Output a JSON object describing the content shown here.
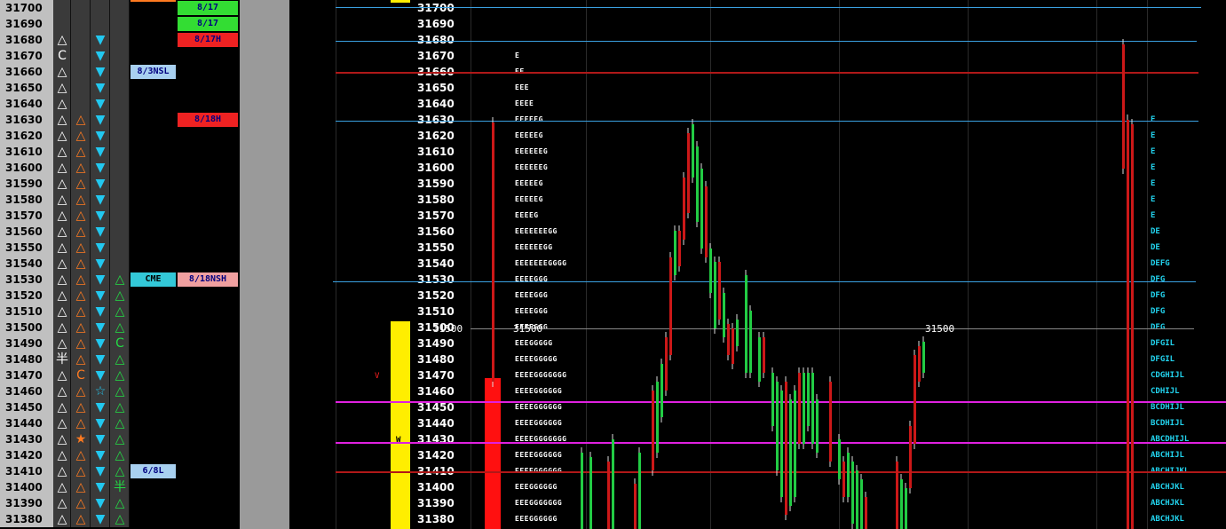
{
  "rows": [
    {
      "price": "31700",
      "c1": "",
      "c2": "",
      "c3": "",
      "c4": "",
      "tagA": "",
      "tagB": "8/17",
      "tpo": "",
      "rtpo": ""
    },
    {
      "price": "31690",
      "c1": "",
      "c2": "",
      "c3": "",
      "c4": "",
      "tagA": "",
      "tagB": "8/17",
      "tpo": "",
      "rtpo": ""
    },
    {
      "price": "31680",
      "c1": "△",
      "c2": "",
      "c3": "▼",
      "c4": "",
      "tagA": "",
      "tagB": "8/17H",
      "tpo": "",
      "rtpo": ""
    },
    {
      "price": "31670",
      "c1": "C",
      "c2": "",
      "c3": "▼",
      "c4": "",
      "tagA": "",
      "tagB": "",
      "tpo": "E",
      "rtpo": ""
    },
    {
      "price": "31660",
      "c1": "△",
      "c2": "",
      "c3": "▼",
      "c4": "",
      "tagA": "8/3NSL",
      "tagB": "",
      "tpo": "EE",
      "rtpo": ""
    },
    {
      "price": "31650",
      "c1": "△",
      "c2": "",
      "c3": "▼",
      "c4": "",
      "tagA": "",
      "tagB": "",
      "tpo": "EEE",
      "rtpo": ""
    },
    {
      "price": "31640",
      "c1": "△",
      "c2": "",
      "c3": "▼",
      "c4": "",
      "tagA": "",
      "tagB": "",
      "tpo": "EEEE",
      "rtpo": ""
    },
    {
      "price": "31630",
      "c1": "△",
      "c2": "△",
      "c3": "▼",
      "c4": "",
      "tagA": "",
      "tagB": "8/18H",
      "tpo": "EEEEEG",
      "rtpo": "E"
    },
    {
      "price": "31620",
      "c1": "△",
      "c2": "△",
      "c3": "▼",
      "c4": "",
      "tagA": "",
      "tagB": "",
      "tpo": "EEEEEG",
      "rtpo": "E"
    },
    {
      "price": "31610",
      "c1": "△",
      "c2": "△",
      "c3": "▼",
      "c4": "",
      "tagA": "",
      "tagB": "",
      "tpo": "EEEEEEG",
      "rtpo": "E"
    },
    {
      "price": "31600",
      "c1": "△",
      "c2": "△",
      "c3": "▼",
      "c4": "",
      "tagA": "",
      "tagB": "",
      "tpo": "EEEEEEG",
      "rtpo": "E"
    },
    {
      "price": "31590",
      "c1": "△",
      "c2": "△",
      "c3": "▼",
      "c4": "",
      "tagA": "",
      "tagB": "",
      "tpo": "EEEEEG",
      "rtpo": "E"
    },
    {
      "price": "31580",
      "c1": "△",
      "c2": "△",
      "c3": "▼",
      "c4": "",
      "tagA": "",
      "tagB": "",
      "tpo": "EEEEEG",
      "rtpo": "E"
    },
    {
      "price": "31570",
      "c1": "△",
      "c2": "△",
      "c3": "▼",
      "c4": "",
      "tagA": "",
      "tagB": "",
      "tpo": "EEEEG",
      "rtpo": "E"
    },
    {
      "price": "31560",
      "c1": "△",
      "c2": "△",
      "c3": "▼",
      "c4": "",
      "tagA": "",
      "tagB": "",
      "tpo": "EEEEEEEGG",
      "rtpo": "DE"
    },
    {
      "price": "31550",
      "c1": "△",
      "c2": "△",
      "c3": "▼",
      "c4": "",
      "tagA": "",
      "tagB": "",
      "tpo": "EEEEEEGG",
      "rtpo": "DE"
    },
    {
      "price": "31540",
      "c1": "△",
      "c2": "△",
      "c3": "▼",
      "c4": "",
      "tagA": "",
      "tagB": "",
      "tpo": "EEEEEEEGGGG",
      "rtpo": "DEFG"
    },
    {
      "price": "31530",
      "c1": "△",
      "c2": "△",
      "c3": "▼",
      "c4": "△",
      "tagA": "CME",
      "tagB": "8/18NSH",
      "tpo": "EEEEGGG",
      "rtpo": "DFG"
    },
    {
      "price": "31520",
      "c1": "△",
      "c2": "△",
      "c3": "▼",
      "c4": "△",
      "tagA": "",
      "tagB": "",
      "tpo": "EEEEGGG",
      "rtpo": "DFG"
    },
    {
      "price": "31510",
      "c1": "△",
      "c2": "△",
      "c3": "▼",
      "c4": "△",
      "tagA": "",
      "tagB": "",
      "tpo": "EEEEGGG",
      "rtpo": "DFG"
    },
    {
      "price": "31500",
      "c1": "△",
      "c2": "△",
      "c3": "▼",
      "c4": "△",
      "tagA": "",
      "tagB": "",
      "tpo": "EEEEGGG",
      "rtpo": "DFG"
    },
    {
      "price": "31490",
      "c1": "△",
      "c2": "△",
      "c3": "▼",
      "c4": "C",
      "tagA": "",
      "tagB": "",
      "tpo": "EEEGGGGG",
      "rtpo": "DFGIL"
    },
    {
      "price": "31480",
      "c1": "半",
      "c2": "△",
      "c3": "▼",
      "c4": "△",
      "tagA": "",
      "tagB": "",
      "tpo": "EEEEGGGGG",
      "rtpo": "DFGIL"
    },
    {
      "price": "31470",
      "c1": "△",
      "c2": "C",
      "c3": "▼",
      "c4": "△",
      "tagA": "",
      "tagB": "",
      "tpo": "EEEEGGGGGGG",
      "rtpo": "CDGHIJL"
    },
    {
      "price": "31460",
      "c1": "△",
      "c2": "△",
      "c3": "☆",
      "c4": "△",
      "tagA": "",
      "tagB": "",
      "tpo": "EEEEGGGGGG",
      "rtpo": "CDHIJL"
    },
    {
      "price": "31450",
      "c1": "△",
      "c2": "△",
      "c3": "▼",
      "c4": "△",
      "tagA": "",
      "tagB": "",
      "tpo": "EEEEGGGGGG",
      "rtpo": "BCDHIJL"
    },
    {
      "price": "31440",
      "c1": "△",
      "c2": "△",
      "c3": "▼",
      "c4": "△",
      "tagA": "",
      "tagB": "",
      "tpo": "EEEEGGGGGG",
      "rtpo": "BCDHIJL"
    },
    {
      "price": "31430",
      "c1": "△",
      "c2": "★",
      "c3": "▼",
      "c4": "△",
      "tagA": "",
      "tagB": "",
      "tpo": "EEEEGGGGGGG",
      "rtpo": "ABCDHIJL"
    },
    {
      "price": "31420",
      "c1": "△",
      "c2": "△",
      "c3": "▼",
      "c4": "△",
      "tagA": "",
      "tagB": "",
      "tpo": "EEEEGGGGGG",
      "rtpo": "ABCHIJL"
    },
    {
      "price": "31410",
      "c1": "△",
      "c2": "△",
      "c3": "▼",
      "c4": "△",
      "tagA": "6/8L",
      "tagB": "",
      "tpo": "EEEEGGGGGG",
      "rtpo": "ABCHIJKL"
    },
    {
      "price": "31400",
      "c1": "△",
      "c2": "△",
      "c3": "▼",
      "c4": "半",
      "tagA": "",
      "tagB": "",
      "tpo": "EEEGGGGGG",
      "rtpo": "ABCHJKL"
    },
    {
      "price": "31390",
      "c1": "△",
      "c2": "△",
      "c3": "▼",
      "c4": "△",
      "tagA": "",
      "tagB": "",
      "tpo": "EEEGGGGGGG",
      "rtpo": "ABCHJKL"
    },
    {
      "price": "31380",
      "c1": "△",
      "c2": "△",
      "c3": "▼",
      "c4": "△",
      "tagA": "",
      "tagB": "",
      "tpo": "EEEGGGGGG",
      "rtpo": "ABCHJKL"
    }
  ],
  "overlay": {
    "price_label_left": "31500",
    "price_label_mid": "31500",
    "price_label_right": "31500",
    "marker_v": "V",
    "marker_w": "W"
  },
  "colors": {
    "blue_line": "#3aa0e0",
    "red_line": "#b01818",
    "magenta_line": "#e020e0",
    "green_tag": "#33dd33",
    "red_tag": "#ee2222",
    "blue_tag": "#a8d0f0",
    "cyan_tag": "#33c8d8",
    "pink_tag": "#f0a0a0",
    "yellow_bar": "#ffee00",
    "red_bar": "#ff1010",
    "white_tri": "#ffffff",
    "orange_tri": "#ff7a20",
    "cyan_tri": "#22c8f0",
    "green_tri": "#22dd44"
  }
}
